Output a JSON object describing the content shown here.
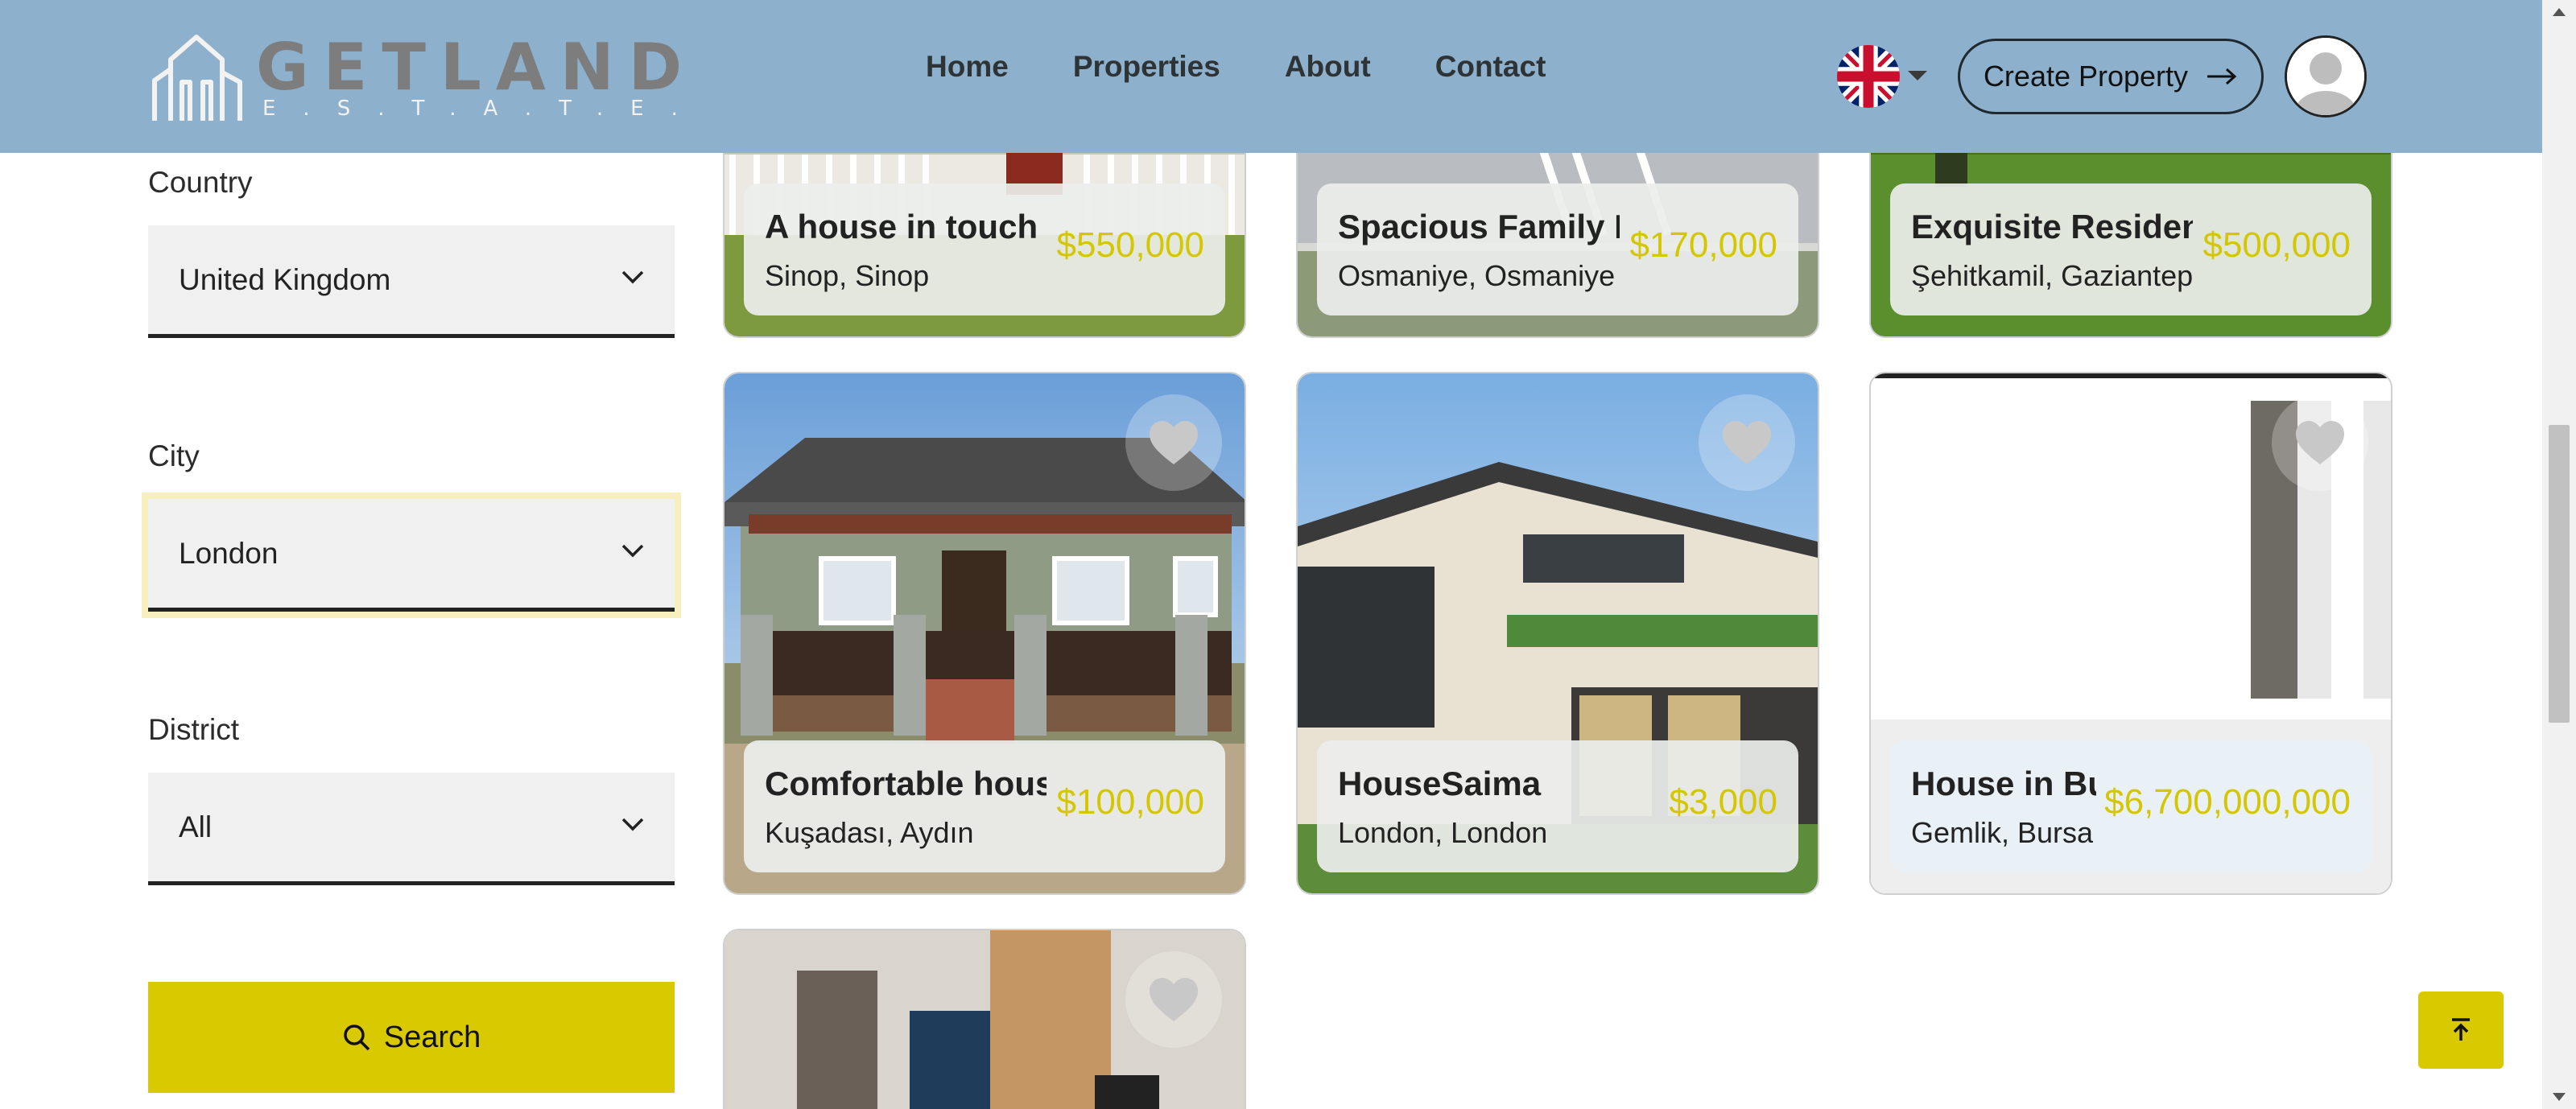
{
  "header": {
    "logo_word": "GETLAND",
    "logo_sub": "ESTATE",
    "nav": [
      "Home",
      "Properties",
      "About",
      "Contact"
    ],
    "create_label": "Create Property"
  },
  "filters": {
    "country_label": "Country",
    "country_value": "United Kingdom",
    "city_label": "City",
    "city_value": "London",
    "district_label": "District",
    "district_value": "All",
    "search_label": "Search"
  },
  "properties": [
    {
      "title": "A house in touch wi",
      "location": "Sinop, Sinop",
      "price": "$550,000"
    },
    {
      "title": "Spacious Family Ho",
      "location": "Osmaniye, Osmaniye",
      "price": "$170,000"
    },
    {
      "title": "Exquisite Residenc",
      "location": "Şehitkamil, Gaziantep",
      "price": "$500,000"
    },
    {
      "title": "Comfortable house",
      "location": "Kuşadası, Aydın",
      "price": "$100,000"
    },
    {
      "title": "HouseSaima",
      "location": "London, London",
      "price": "$3,000"
    },
    {
      "title": "House in Burs",
      "location": "Gemlik, Bursa",
      "price": "$6,700,000,000"
    }
  ],
  "colors": {
    "header_bg": "#8db0cc",
    "accent": "#d9c900",
    "price": "#d4c700"
  },
  "icons": [
    "uk-flag-icon",
    "chevron-down-icon",
    "arrow-right-icon",
    "user-avatar-icon",
    "search-icon",
    "heart-icon",
    "arrow-up-to-top-icon"
  ]
}
